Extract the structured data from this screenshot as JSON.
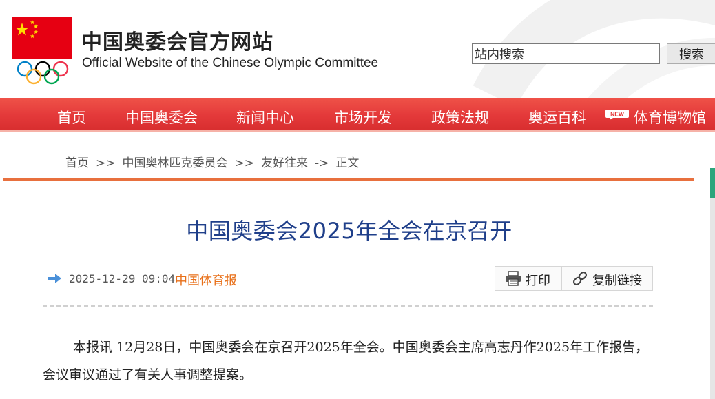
{
  "header": {
    "title_cn": "中国奥委会官方网站",
    "title_en": "Official Website of the Chinese Olympic Committee",
    "search": {
      "placeholder": "站内搜索",
      "value": "站内搜索",
      "button_label": "搜索"
    }
  },
  "nav": {
    "items": [
      {
        "label": "首页"
      },
      {
        "label": "中国奥委会"
      },
      {
        "label": "新闻中心"
      },
      {
        "label": "市场开发"
      },
      {
        "label": "政策法规"
      },
      {
        "label": "奥运百科"
      },
      {
        "label": "体育博物馆",
        "badge": "NEW"
      }
    ]
  },
  "breadcrumb": {
    "items": [
      "首页",
      "中国奥林匹克委员会",
      "友好往来",
      "正文"
    ],
    "separators": [
      ">>",
      ">>",
      "->"
    ]
  },
  "article": {
    "title": "中国奥委会2025年全会在京召开",
    "date": "2025-12-29 09:04",
    "source": "中国体育报",
    "print_label": "打印",
    "copy_label": "复制链接",
    "paragraph": "本报讯 12月28日，中国奥委会在京召开2025年全会。中国奥委会主席高志丹作2025年工作报告，会议审议通过了有关人事调整提案。"
  },
  "colors": {
    "nav_red": "#e4393a",
    "title_blue": "#1f3f8a",
    "source_orange": "#e8701a",
    "rule_orange": "#e8703e",
    "flag_red": "#e60012",
    "star_yellow": "#ffde00"
  },
  "icons": {
    "flag": "china-flag-icon",
    "rings": "olympic-rings-icon",
    "arrow": "arrow-right-icon",
    "print": "printer-icon",
    "copy": "link-icon"
  }
}
